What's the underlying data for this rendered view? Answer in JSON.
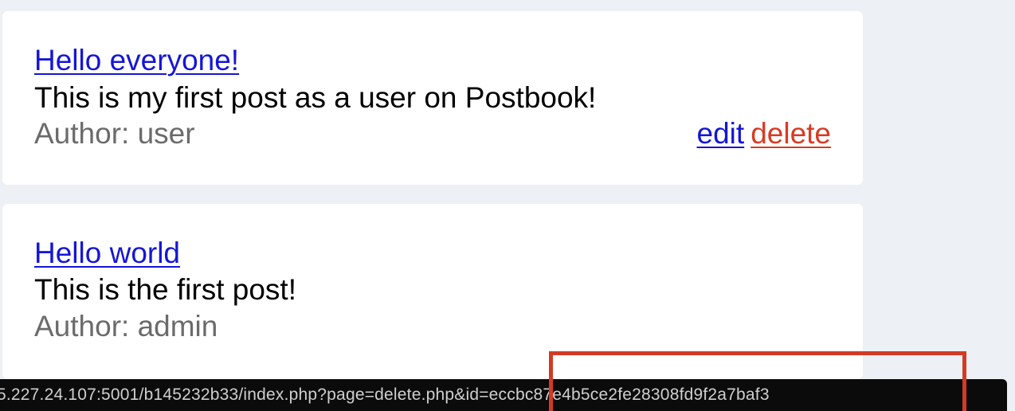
{
  "posts": [
    {
      "title": "Hello everyone!",
      "body": "This is my first post as a user on Postbook!",
      "author": "Author: user",
      "actions": {
        "edit": "edit",
        "delete": "delete"
      }
    },
    {
      "title": "Hello world",
      "body": "This is the first post!",
      "author": "Author: admin"
    }
  ],
  "status_bar": {
    "url": "5.227.24.107:5001/b145232b33/index.php?page=delete.php&id=eccbc87e4b5ce2fe28308fd9f2a7baf3"
  },
  "colors": {
    "link": "#1515d8",
    "delete": "#d93a24",
    "highlight": "#d33a24",
    "background": "#edf0f4"
  }
}
